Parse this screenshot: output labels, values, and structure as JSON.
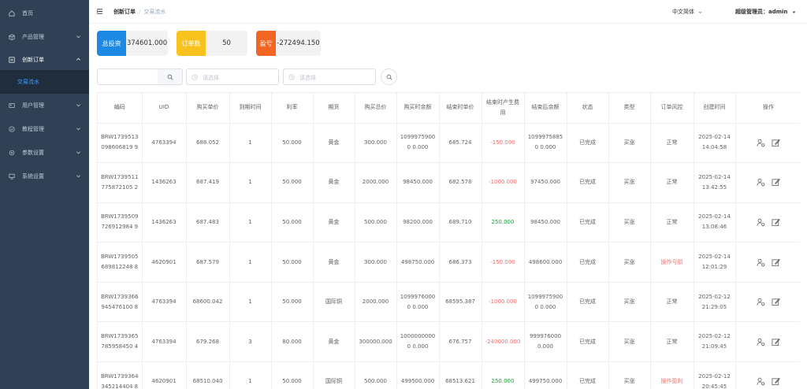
{
  "sidebar": {
    "items": [
      {
        "label": "首页",
        "icon": "home-icon"
      },
      {
        "label": "产品管理",
        "icon": "box-icon"
      },
      {
        "label": "创新订单",
        "icon": "order-icon"
      },
      {
        "label": "用户管理",
        "icon": "user-icon"
      },
      {
        "label": "教程管理",
        "icon": "doc-icon"
      },
      {
        "label": "参数设置",
        "icon": "settings-icon"
      },
      {
        "label": "系统设置",
        "icon": "monitor-icon"
      }
    ],
    "submenu_active": "交易流水"
  },
  "header": {
    "breadcrumb": [
      "创新订单",
      "交易流水"
    ],
    "language": "中文简体",
    "user": "超级管理员：admin"
  },
  "stats": [
    {
      "label": "总投资",
      "value": "374601.000",
      "color": "#1e88e5"
    },
    {
      "label": "订单数",
      "value": "50",
      "color": "#f9c31f"
    },
    {
      "label": "盈亏",
      "value": "-272494.150",
      "color": "#f26522"
    }
  ],
  "filters": {
    "search_placeholder": "",
    "start_placeholder": "请选择",
    "end_placeholder": "请选择"
  },
  "table": {
    "headers": [
      "编码",
      "UID",
      "购买单价",
      "到期时间",
      "利率",
      "期货",
      "购买总价",
      "购买时余额",
      "结束时单价",
      "结束时产生费用",
      "结束后余额",
      "状态",
      "类型",
      "订单风控",
      "创建时间",
      "操作"
    ],
    "rows": [
      [
        "BRW1739513098606819 9",
        "4763394",
        "688.052",
        "1",
        "50.000",
        "黄金",
        "300.000",
        "10999759000 0.000",
        "685.724",
        "-150.000",
        "10999758850 0.000",
        "已完成",
        "买涨",
        "正常",
        "2025-02-14 14:04:58"
      ],
      [
        "BRW1739511775872105 2",
        "1436263",
        "687.419",
        "1",
        "50.000",
        "黄金",
        "2000.000",
        "98450.000",
        "682.578",
        "-1000.000",
        "97450.000",
        "已完成",
        "买涨",
        "正常",
        "2025-02-14 13:42:55"
      ],
      [
        "BRW1739509726912984 9",
        "1436263",
        "687.483",
        "1",
        "50.000",
        "黄金",
        "500.000",
        "98200.000",
        "689.710",
        "250.000",
        "98450.000",
        "已完成",
        "买涨",
        "正常",
        "2025-02-14 13:08:46"
      ],
      [
        "BRW1739505689812248 8",
        "4620901",
        "687.579",
        "1",
        "50.000",
        "黄金",
        "300.000",
        "498750.000",
        "686.373",
        "-150.000",
        "498600.000",
        "已完成",
        "买涨",
        "操作亏损",
        "2025-02-14 12:01:29"
      ],
      [
        "BRW1739366945476100 8",
        "4763394",
        "68600.042",
        "1",
        "50.000",
        "国际铜",
        "2000.000",
        "10999760000 0.000",
        "68595.387",
        "-1000.000",
        "10999759000 0.000",
        "已完成",
        "买涨",
        "正常",
        "2025-02-12 21:29:05"
      ],
      [
        "BRW1739365785958450 4",
        "4763394",
        "679.268",
        "3",
        "80.000",
        "黄金",
        "300000.000",
        "10000000000 0.000",
        "676.757",
        "-240000.000",
        "999976000 0.000",
        "已完成",
        "买涨",
        "正常",
        "2025-02-12 21:09:45"
      ],
      [
        "BRW1739364345214404 8",
        "4620901",
        "68510.040",
        "1",
        "50.000",
        "国际铜",
        "500.000",
        "499500.000",
        "68513.621",
        "250.000",
        "499750.000",
        "已完成",
        "买涨",
        "操作盈利",
        "2025-02-12 20:45:45"
      ]
    ],
    "profit_class": [
      "red",
      "red",
      "green",
      "red",
      "red",
      "red",
      "green"
    ],
    "risk_class": [
      "",
      "",
      "",
      "red",
      "",
      "",
      "red"
    ]
  }
}
